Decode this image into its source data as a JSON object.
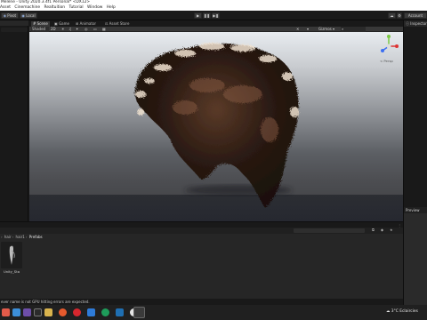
{
  "window": {
    "title": "Melene - Unity 2020.3.4f1 Personal* <DX12>"
  },
  "menu": {
    "items": [
      "Asset",
      "Cinemachine",
      "Realtuition",
      "Tutorial",
      "Window",
      "Help"
    ]
  },
  "toolbar": {
    "pivot_label": "Pivot",
    "local_label": "Local",
    "account_label": "Account"
  },
  "scene_tabs": [
    {
      "label": "Scene"
    },
    {
      "label": "Game"
    },
    {
      "label": "Animator"
    },
    {
      "label": "Asset Store"
    }
  ],
  "scene_toolbar": {
    "shading_mode": "Shaded",
    "gizmos_label": "Gizmos"
  },
  "gizmo": {
    "persp_label": "< Persp"
  },
  "right_panels": {
    "inspector_label": "Inspector",
    "preview_label": "Preview"
  },
  "project": {
    "breadcrumb": [
      "",
      "hair",
      "hair1",
      "Prefabs"
    ],
    "asset_name": "Unity_Sta"
  },
  "status": {
    "message": "ever name is not GPU hitting errors are expected."
  },
  "taskbar": {
    "weather": "3°C  Eclaircies"
  },
  "colors": {
    "sky_top": "#e8ecf0",
    "horizon": "#4d4e52",
    "hair_dark": "#2a1a12",
    "hair_tip": "#f0e2d0",
    "gizmo_blue": "#3d6ff2",
    "gizmo_green": "#7ac943"
  }
}
